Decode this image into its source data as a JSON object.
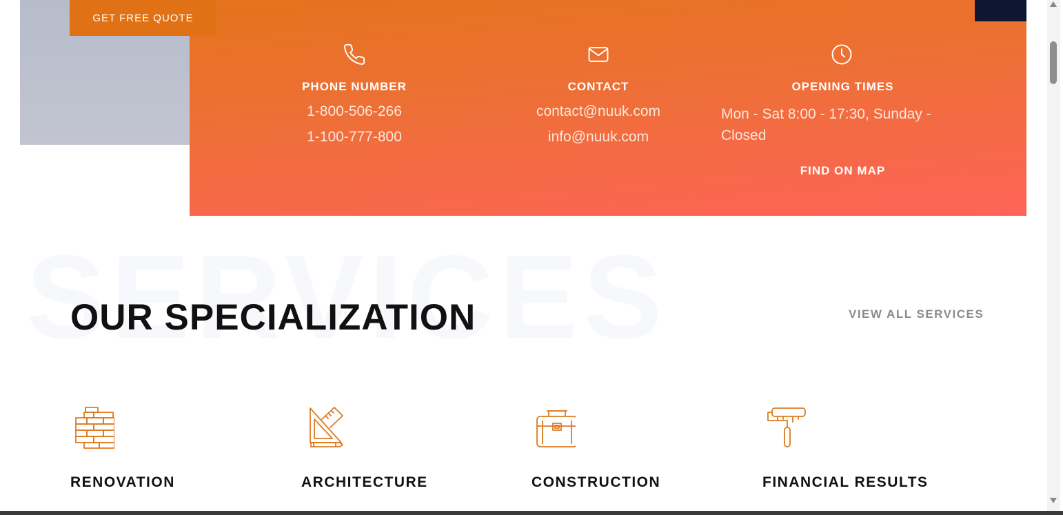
{
  "header": {
    "quote_button": "GET FREE QUOTE"
  },
  "info": {
    "phone": {
      "title": "PHONE NUMBER",
      "lines": [
        "1-800-506-266",
        "1-100-777-800"
      ],
      "icon": "phone-icon"
    },
    "contact": {
      "title": "CONTACT",
      "lines": [
        "contact@nuuk.com",
        "info@nuuk.com"
      ],
      "icon": "mail-icon"
    },
    "hours": {
      "title": "OPENING TIMES",
      "text": "Mon - Sat 8:00 - 17:30, Sunday - Closed",
      "link": "FIND ON MAP",
      "icon": "clock-icon"
    }
  },
  "services": {
    "background_word": "SERVICES",
    "title": "OUR SPECIALIZATION",
    "view_all": "VIEW ALL SERVICES",
    "items": [
      {
        "title": "RENOVATION",
        "icon": "bricks-icon"
      },
      {
        "title": "ARCHITECTURE",
        "icon": "ruler-triangle-icon"
      },
      {
        "title": "CONSTRUCTION",
        "icon": "toolbox-icon"
      },
      {
        "title": "FINANCIAL RESULTS",
        "icon": "paint-roller-icon"
      }
    ]
  },
  "colors": {
    "accent": "#e07215",
    "gradient_top": "#e5731c",
    "gradient_bottom": "#fe6358",
    "navy": "#0f1630",
    "icon_orange": "#dd7a21"
  }
}
